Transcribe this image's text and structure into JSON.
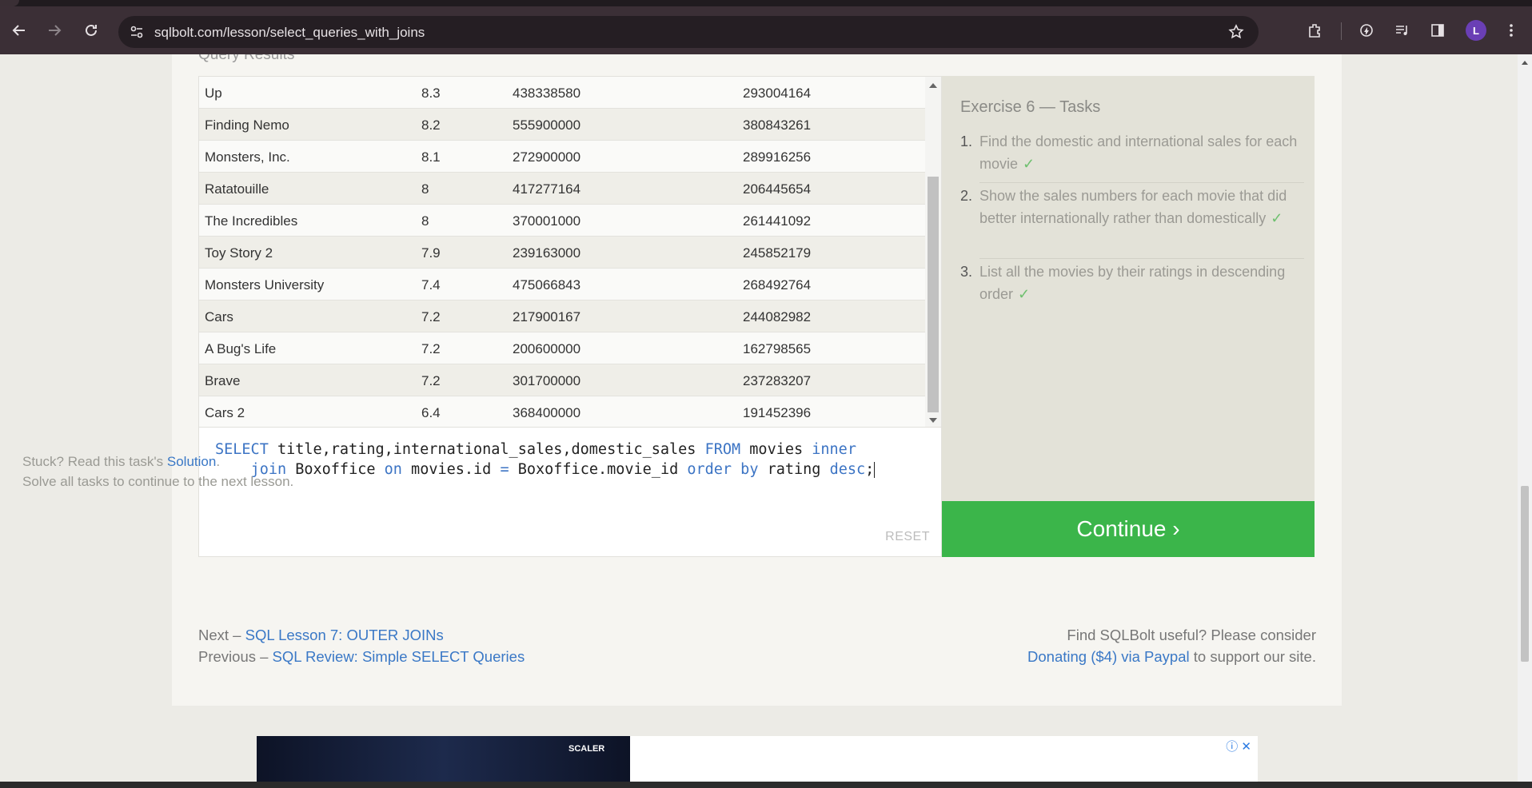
{
  "browser": {
    "url": "sqlbolt.com/lesson/select_queries_with_joins",
    "avatar_letter": "L"
  },
  "results": {
    "label": "Query Results",
    "rows": [
      {
        "title": "Up",
        "rating": "8.3",
        "international_sales": "438338580",
        "domestic_sales": "293004164"
      },
      {
        "title": "Finding Nemo",
        "rating": "8.2",
        "international_sales": "555900000",
        "domestic_sales": "380843261"
      },
      {
        "title": "Monsters, Inc.",
        "rating": "8.1",
        "international_sales": "272900000",
        "domestic_sales": "289916256"
      },
      {
        "title": "Ratatouille",
        "rating": "8",
        "international_sales": "417277164",
        "domestic_sales": "206445654"
      },
      {
        "title": "The Incredibles",
        "rating": "8",
        "international_sales": "370001000",
        "domestic_sales": "261441092"
      },
      {
        "title": "Toy Story 2",
        "rating": "7.9",
        "international_sales": "239163000",
        "domestic_sales": "245852179"
      },
      {
        "title": "Monsters University",
        "rating": "7.4",
        "international_sales": "475066843",
        "domestic_sales": "268492764"
      },
      {
        "title": "Cars",
        "rating": "7.2",
        "international_sales": "217900167",
        "domestic_sales": "244082982"
      },
      {
        "title": "A Bug's Life",
        "rating": "7.2",
        "international_sales": "200600000",
        "domestic_sales": "162798565"
      },
      {
        "title": "Brave",
        "rating": "7.2",
        "international_sales": "301700000",
        "domestic_sales": "237283207"
      },
      {
        "title": "Cars 2",
        "rating": "6.4",
        "international_sales": "368400000",
        "domestic_sales": "191452396"
      }
    ]
  },
  "editor": {
    "line1": [
      {
        "t": "SELECT",
        "kw": true
      },
      {
        "t": " title,rating,international_sales,domestic_sales ",
        "kw": false
      },
      {
        "t": "FROM",
        "kw": true
      },
      {
        "t": " movies ",
        "kw": false
      },
      {
        "t": "inner",
        "kw": true
      }
    ],
    "line2": [
      {
        "t": "    join",
        "kw": true
      },
      {
        "t": " Boxoffice ",
        "kw": false
      },
      {
        "t": "on",
        "kw": true
      },
      {
        "t": " movies.id ",
        "kw": false
      },
      {
        "t": "=",
        "kw": true
      },
      {
        "t": " Boxoffice.movie_id ",
        "kw": false
      },
      {
        "t": "order by",
        "kw": true
      },
      {
        "t": " rating ",
        "kw": false
      },
      {
        "t": "desc",
        "kw": true
      },
      {
        "t": ";",
        "kw": false
      }
    ],
    "reset_label": "RESET"
  },
  "tasks": {
    "title": "Exercise 6 — Tasks",
    "items": [
      {
        "num": "1.",
        "text": "Find the domestic and international sales for each movie",
        "check": "✓"
      },
      {
        "num": "2.",
        "text": "Show the sales numbers for each movie that did better internationally rather than domestically",
        "check": "✓"
      },
      {
        "num": "3.",
        "text": "List all the movies by their ratings in descending order",
        "check": "✓"
      }
    ],
    "stuck_prefix": "Stuck? Read this task's ",
    "solution_link": "Solution",
    "stuck_suffix": ".",
    "solve_all": "Solve all tasks to continue to the next lesson.",
    "continue_label": "Continue ›"
  },
  "footer": {
    "next_prefix": "Next – ",
    "next_link": "SQL Lesson 7: OUTER JOINs",
    "prev_prefix": "Previous – ",
    "prev_link": "SQL Review: Simple SELECT Queries",
    "useful": "Find SQLBolt useful? Please consider",
    "donate_link": "Donating ($4) via Paypal",
    "donate_suffix": " to support our site."
  },
  "ad": {
    "brand": "SCALER",
    "icons": "ⓘ ✕"
  },
  "colors": {
    "accent_green": "#3bb54a",
    "link_blue": "#3a78c6",
    "keyword_blue": "#3c74c4"
  }
}
